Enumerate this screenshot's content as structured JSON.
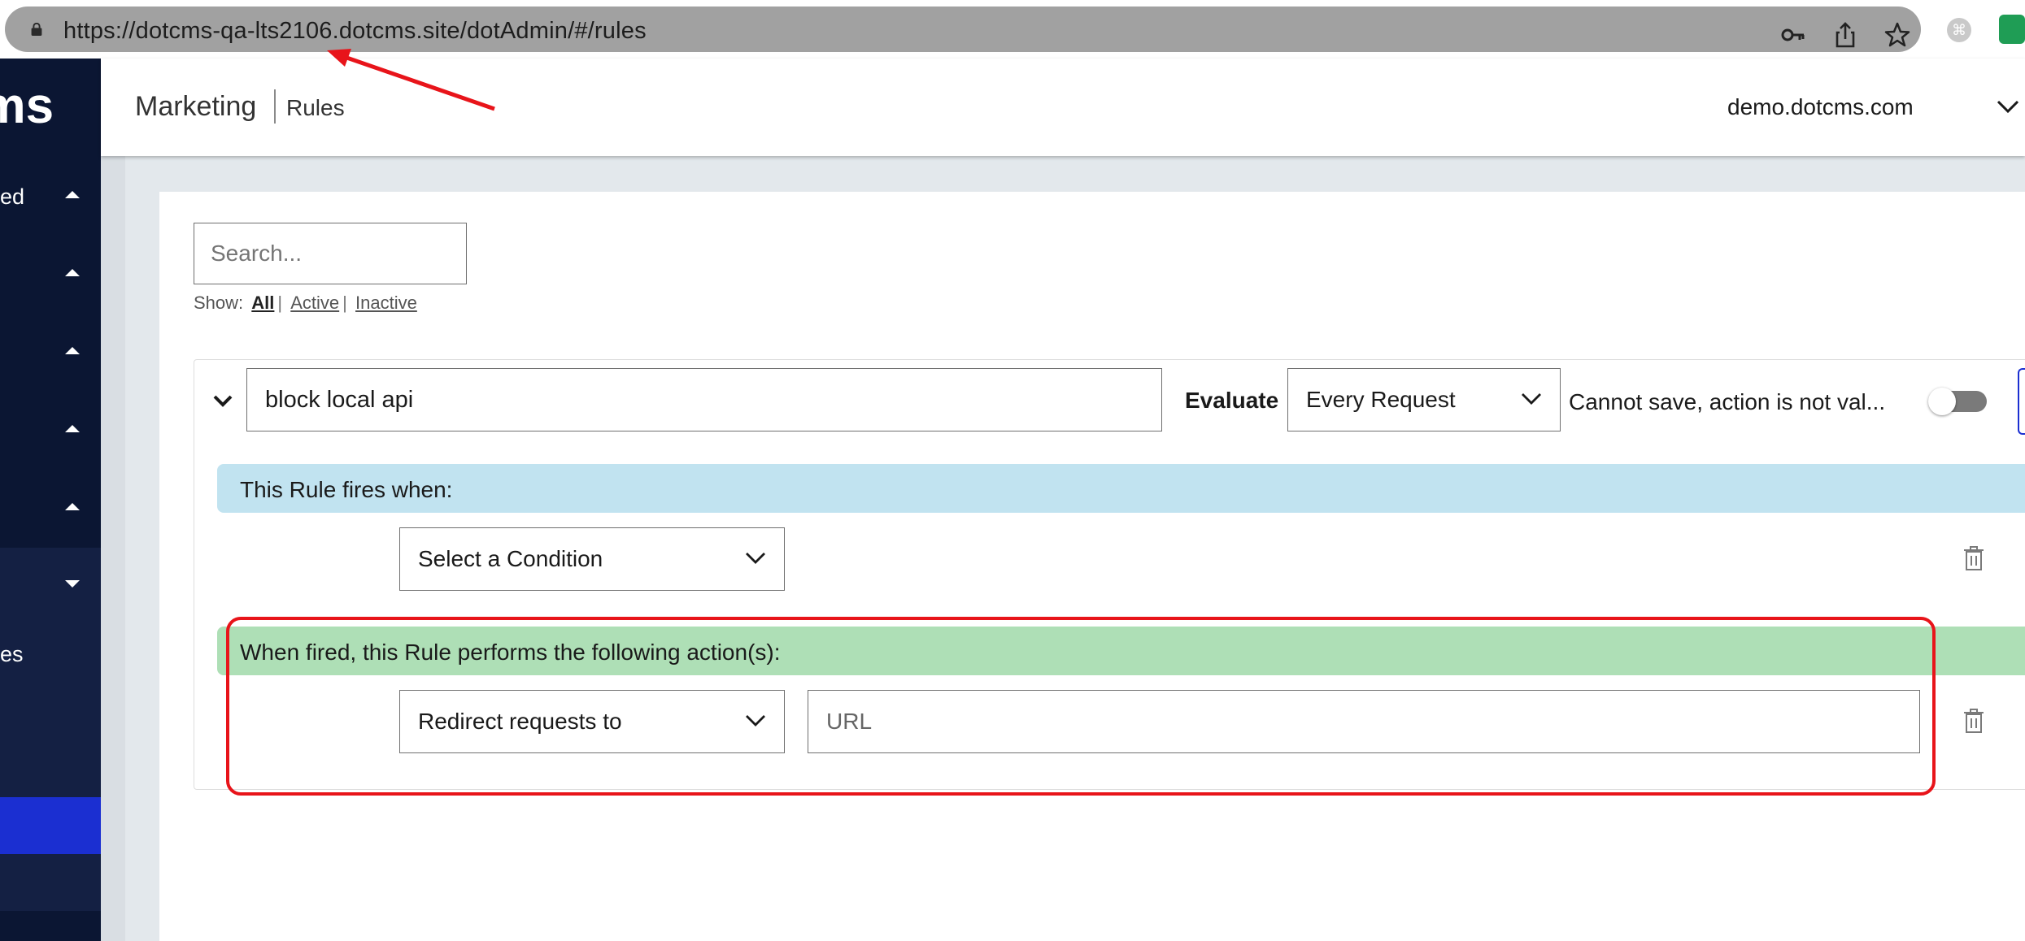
{
  "browser": {
    "url": "https://dotcms-qa-lts2106.dotcms.site/dotAdmin/#/rules",
    "icons": [
      "lock-icon",
      "key-icon",
      "share-icon",
      "star-icon",
      "extension-icon",
      "extension-green-icon"
    ],
    "ext1_glyph": "⌘"
  },
  "sidebar": {
    "logo_text": "cms",
    "items": [
      {
        "label": "ed",
        "caret": "up"
      },
      {
        "label": "",
        "caret": "up"
      },
      {
        "label": "",
        "caret": "up"
      },
      {
        "label": "",
        "caret": "up"
      },
      {
        "label": "",
        "caret": "up"
      },
      {
        "label": "",
        "caret": "down"
      }
    ],
    "sub_item_label": "es"
  },
  "header": {
    "breadcrumb_main": "Marketing",
    "breadcrumb_sub": "Rules",
    "site_name": "demo.dotcms.com"
  },
  "search": {
    "placeholder": "Search...",
    "show_label": "Show:",
    "filters": [
      "All",
      "Active",
      "Inactive"
    ],
    "separator": "|"
  },
  "rule": {
    "name": "block local api",
    "evaluate_label": "Evaluate",
    "evaluate_value": "Every Request",
    "warning": "Cannot save, action is not val...",
    "enabled": false,
    "conditions_banner": "This Rule fires when:",
    "condition_select": "Select a Condition",
    "actions_banner": "When fired, this Rule performs the following action(s):",
    "action_select": "Redirect requests to",
    "url_placeholder": "URL"
  },
  "colors": {
    "sidebar_bg": "#0b1633",
    "sidebar_active": "#1b2fd1",
    "conditions_banner": "#c1e3f0",
    "actions_banner": "#aedfb6",
    "annotation_red": "#e8141a"
  }
}
